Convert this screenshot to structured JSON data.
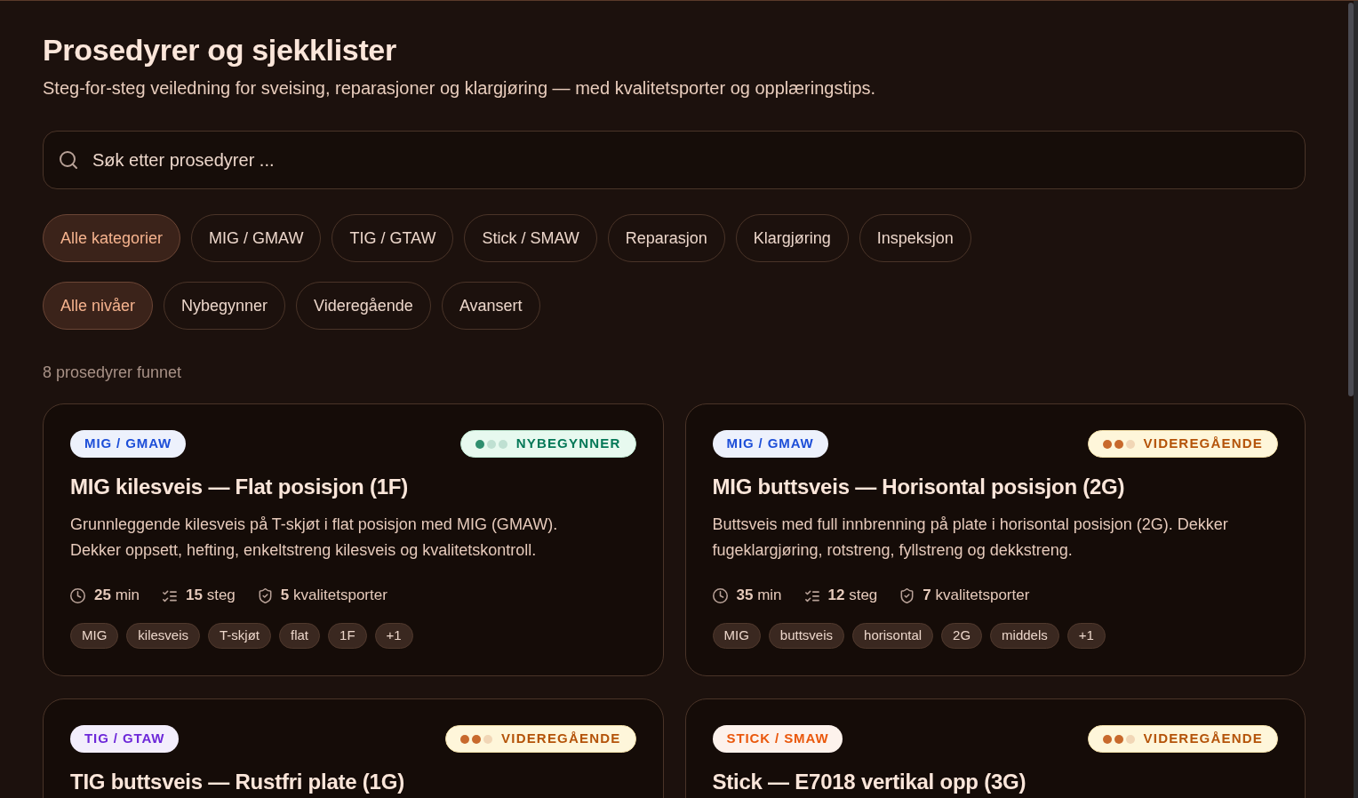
{
  "header": {
    "title": "Prosedyrer og sjekklister",
    "subtitle": "Steg-for-steg veiledning for sveising, reparasjoner og klargjøring — med kvalitetsporter og opplæringstips."
  },
  "search": {
    "placeholder": "Søk etter prosedyrer ..."
  },
  "category_filters": [
    {
      "label": "Alle kategorier",
      "selected": true
    },
    {
      "label": "MIG / GMAW",
      "selected": false
    },
    {
      "label": "TIG / GTAW",
      "selected": false
    },
    {
      "label": "Stick / SMAW",
      "selected": false
    },
    {
      "label": "Reparasjon",
      "selected": false
    },
    {
      "label": "Klargjøring",
      "selected": false
    },
    {
      "label": "Inspeksjon",
      "selected": false
    }
  ],
  "level_filters": [
    {
      "label": "Alle nivåer",
      "selected": true
    },
    {
      "label": "Nybegynner",
      "selected": false
    },
    {
      "label": "Videregående",
      "selected": false
    },
    {
      "label": "Avansert",
      "selected": false
    }
  ],
  "result_count": "8 prosedyrer funnet",
  "cards": [
    {
      "category": {
        "label": "MIG / GMAW",
        "color": "#1d4ed8"
      },
      "level_badge": {
        "kind": "beginner",
        "label": "NYBEGYNNER",
        "stars": 1
      },
      "title": "MIG kilesveis — Flat posisjon (1F)",
      "description": "Grunnleggende kilesveis på T-skjøt i flat posisjon med MIG (GMAW). Dekker oppsett, hefting, enkeltstreng kilesveis og kvalitetskontroll.",
      "meta": [
        {
          "kind": "duration",
          "text": "**25** min"
        },
        {
          "kind": "steps",
          "text": "**15** steg"
        },
        {
          "kind": "quality",
          "text": "**5** kvalitetsporter"
        }
      ],
      "tags": [
        "MIG",
        "kilesveis",
        "T-skjøt",
        "flat",
        "1F",
        "+1"
      ]
    },
    {
      "category": {
        "label": "MIG / GMAW",
        "color": "#1d4ed8"
      },
      "level_badge": {
        "kind": "intermediate",
        "label": "VIDEREGÅENDE",
        "stars": 2
      },
      "title": "MIG buttsveis — Horisontal posisjon (2G)",
      "description": "Buttsveis med full innbrenning på plate i horisontal posisjon (2G). Dekker fugeklargjøring, rotstreng, fyllstreng og dekkstreng.",
      "meta": [
        {
          "kind": "duration",
          "text": "**35** min"
        },
        {
          "kind": "steps",
          "text": "**12** steg"
        },
        {
          "kind": "quality",
          "text": "**7** kvalitetsporter"
        }
      ],
      "tags": [
        "MIG",
        "buttsveis",
        "horisontal",
        "2G",
        "middels",
        "+1"
      ]
    },
    {
      "category": {
        "label": "TIG / GTAW",
        "color": "#6d28d9"
      },
      "level_badge": {
        "kind": "intermediate",
        "label": "VIDEREGÅENDE",
        "stars": 2
      },
      "title": "TIG buttsveis — Rustfri plate (1G)"
    },
    {
      "category": {
        "label": "STICK / SMAW",
        "color": "#ea580c"
      },
      "level_badge": {
        "kind": "intermediate",
        "label": "VIDEREGÅENDE",
        "stars": 2
      },
      "title": "Stick — E7018 vertikal opp (3G)"
    }
  ]
}
